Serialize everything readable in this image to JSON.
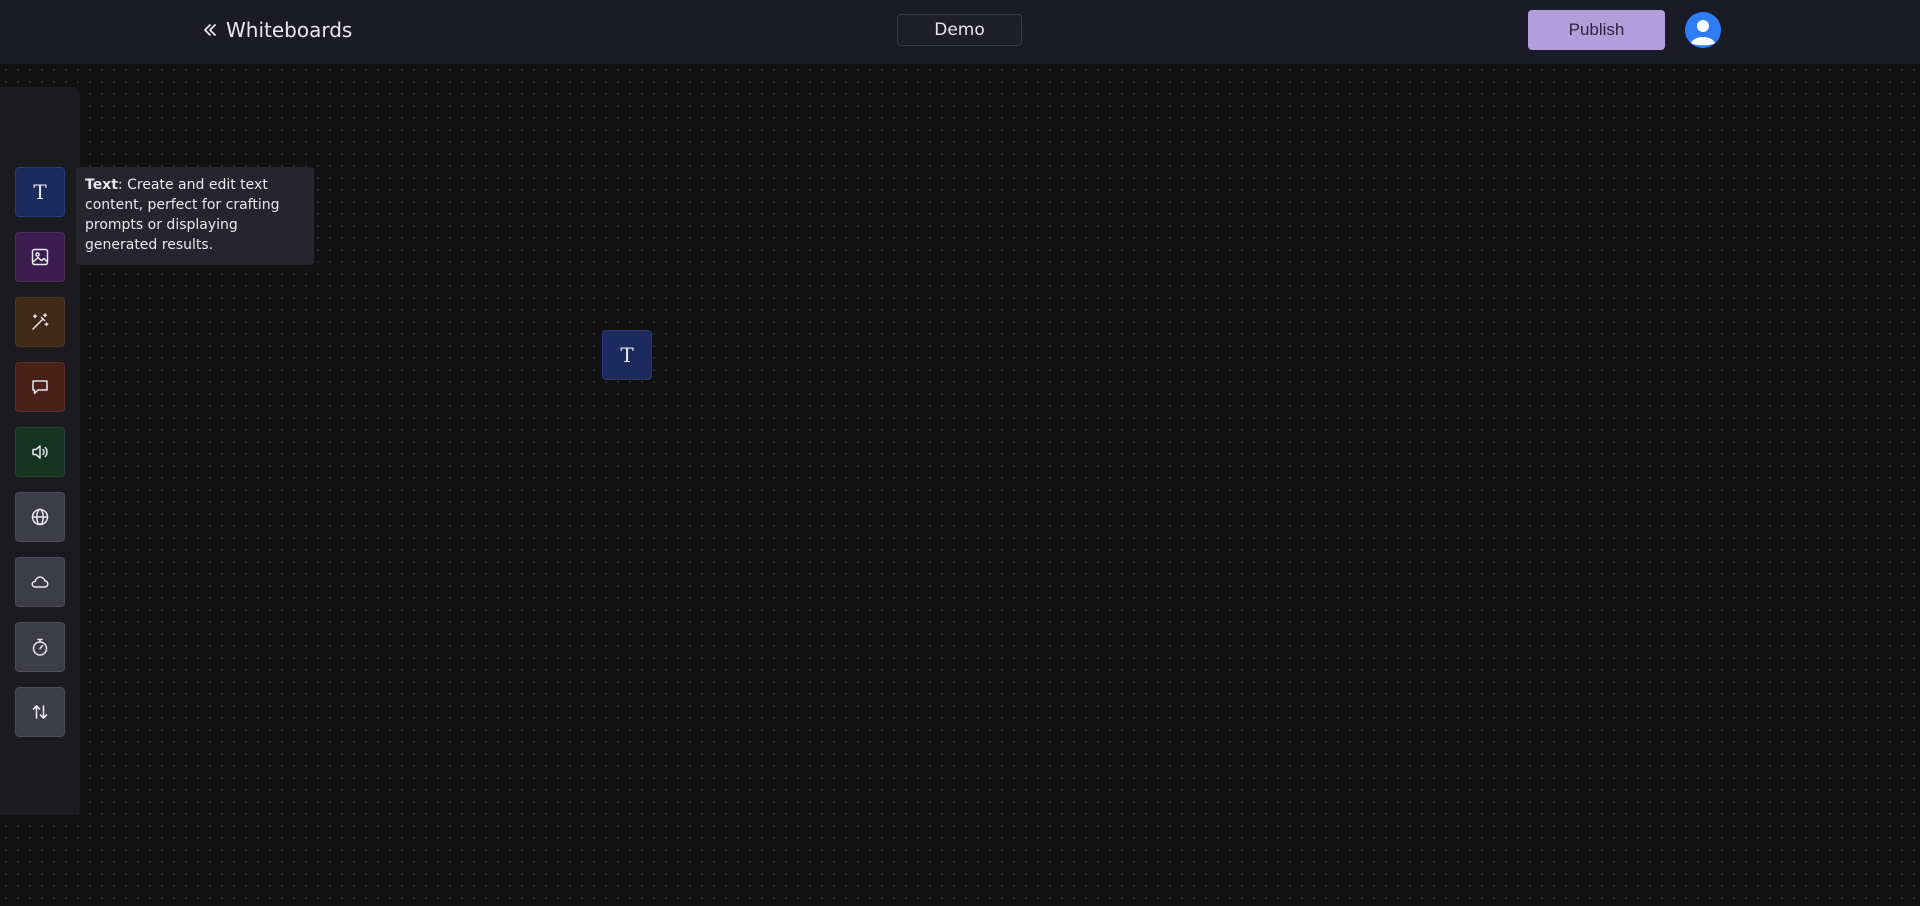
{
  "header": {
    "back_label": "Whiteboards",
    "board_name": "Demo",
    "publish_label": "Publish"
  },
  "toolbar": {
    "tools": [
      {
        "name": "text",
        "icon": "text-icon",
        "glyph": "T",
        "color": "#1d2a5e"
      },
      {
        "name": "image",
        "icon": "image-icon",
        "color": "#3a1c4e"
      },
      {
        "name": "magic",
        "icon": "magic-wand-icon",
        "color": "#3f2a18"
      },
      {
        "name": "chat",
        "icon": "chat-bubble-icon",
        "color": "#4a2118"
      },
      {
        "name": "audio",
        "icon": "speaker-icon",
        "color": "#143322"
      },
      {
        "name": "web",
        "icon": "globe-icon",
        "color": "#3d3d48"
      },
      {
        "name": "cloud",
        "icon": "cloud-icon",
        "color": "#3d3d48"
      },
      {
        "name": "timer",
        "icon": "stopwatch-icon",
        "color": "#3d3d48"
      },
      {
        "name": "transfer",
        "icon": "arrows-up-down-icon",
        "color": "#3d3d48"
      }
    ]
  },
  "tooltip": {
    "title": "Text",
    "body": ": Create and edit text content, perfect for crafting prompts or displaying generated results."
  },
  "canvas": {
    "node_glyph": "T"
  },
  "colors": {
    "accent": "#b39ddb",
    "topbar": "#1b1a27",
    "background": "#121212"
  }
}
